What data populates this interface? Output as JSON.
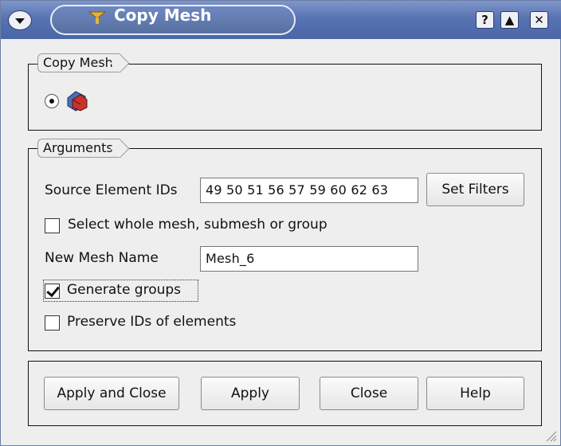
{
  "window": {
    "title": "Copy Mesh",
    "menu_icon": "chevron-down-icon",
    "help_label": "?",
    "shade_label": "▲",
    "close_label": "✕"
  },
  "copy_mesh_group": {
    "legend": "Copy Mesh",
    "radio_selected": true,
    "radio_icon": "copy-mesh-icon"
  },
  "arguments": {
    "legend": "Arguments",
    "source_label": "Source Element IDs",
    "source_value": "49 50 51 56 57 59 60 62 63",
    "set_filters_label": "Set Filters",
    "select_whole_label": "Select whole mesh, submesh or group",
    "select_whole_checked": false,
    "new_mesh_label": "New Mesh Name",
    "new_mesh_value": "Mesh_6",
    "generate_groups_label": "Generate groups",
    "generate_groups_checked": true,
    "preserve_ids_label": "Preserve IDs of elements",
    "preserve_ids_checked": false
  },
  "buttons": {
    "apply_close": "Apply and Close",
    "apply": "Apply",
    "close": "Close",
    "help": "Help"
  },
  "colors": {
    "titlebar": "#5873b2",
    "window_bg": "#eeeeee"
  }
}
